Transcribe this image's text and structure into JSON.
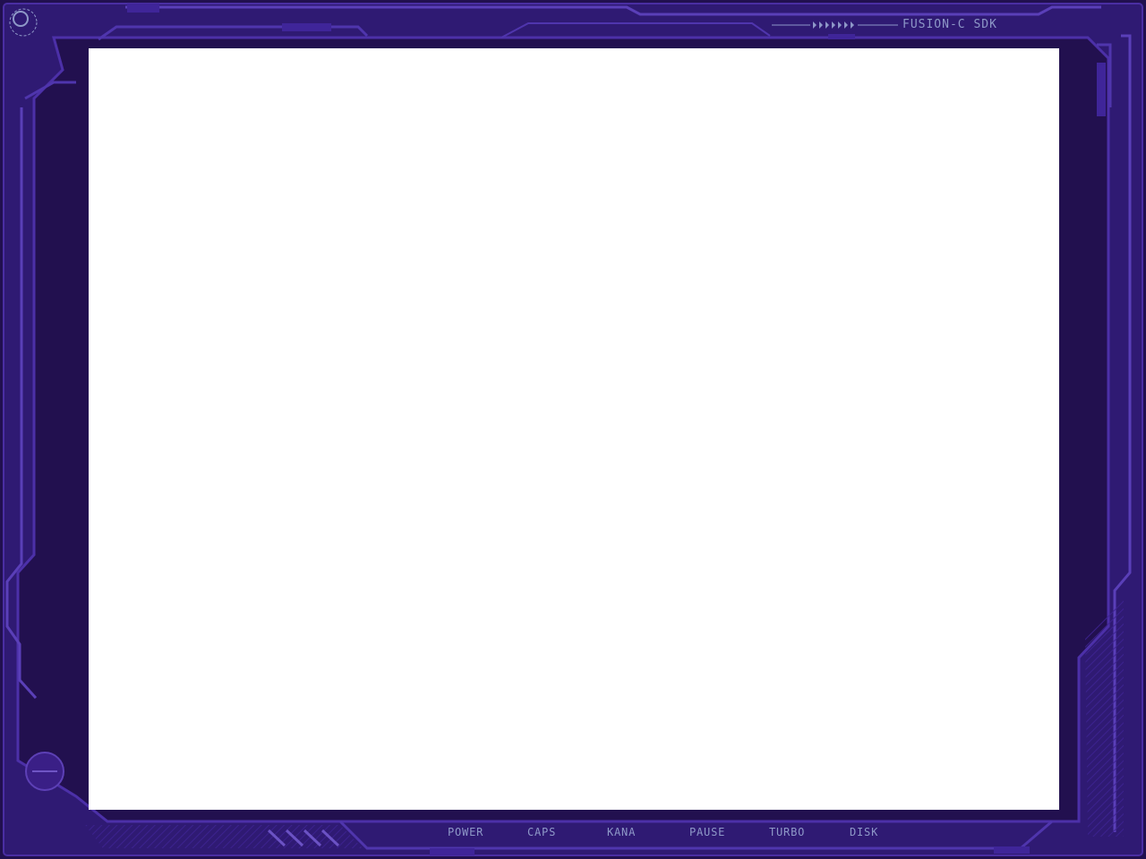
{
  "header": {
    "brand": "FUSION-C SDK"
  },
  "indicators": [
    {
      "label": "POWER"
    },
    {
      "label": "CAPS"
    },
    {
      "label": "KANA"
    },
    {
      "label": "PAUSE"
    },
    {
      "label": "TURBO"
    },
    {
      "label": "DISK"
    }
  ],
  "icons": {
    "top_left": "power-ring-icon",
    "bottom_left": "knob-icon",
    "arrows": "arrow-strip-icon"
  },
  "colors": {
    "frame": "#2f1a73",
    "frame_dark": "#21104f",
    "frame_light": "#4a2ea3",
    "label": "#8e98c8",
    "screen": "#ffffff"
  }
}
